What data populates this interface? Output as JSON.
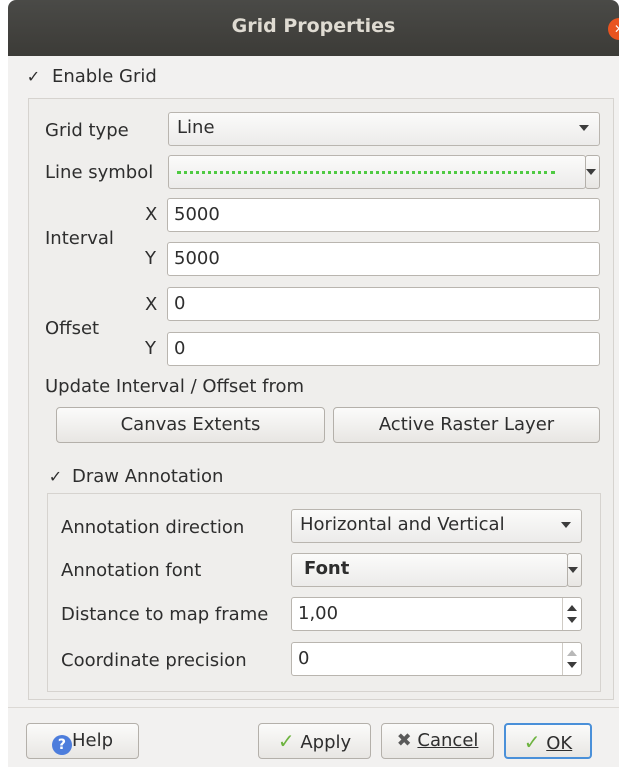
{
  "window": {
    "title": "Grid Properties"
  },
  "enable_grid": {
    "label": "Enable Grid",
    "checked": true
  },
  "grid": {
    "grid_type_label": "Grid type",
    "grid_type_value": "Line",
    "line_symbol_label": "Line symbol",
    "line_symbol_color": "#4fca42",
    "interval_label": "Interval",
    "interval_x_label": "X",
    "interval_x": "5000",
    "interval_y_label": "Y",
    "interval_y": "5000",
    "offset_label": "Offset",
    "offset_x_label": "X",
    "offset_x": "0",
    "offset_y_label": "Y",
    "offset_y": "0",
    "update_from_label": "Update Interval / Offset from",
    "canvas_extents": "Canvas Extents",
    "active_raster_layer": "Active Raster Layer"
  },
  "draw_annotation": {
    "label": "Draw Annotation",
    "checked": true
  },
  "annotation": {
    "direction_label": "Annotation direction",
    "direction_value": "Horizontal and Vertical",
    "font_label": "Annotation font",
    "font_value": "Font",
    "distance_label": "Distance to map frame",
    "distance_value": "1,00",
    "precision_label": "Coordinate precision",
    "precision_value": "0"
  },
  "buttons": {
    "help": "Help",
    "apply": "Apply",
    "cancel": "Cancel",
    "ok": "OK"
  },
  "colors": {
    "accent_close": "#e95420",
    "titlebar": "#3c3b37"
  }
}
